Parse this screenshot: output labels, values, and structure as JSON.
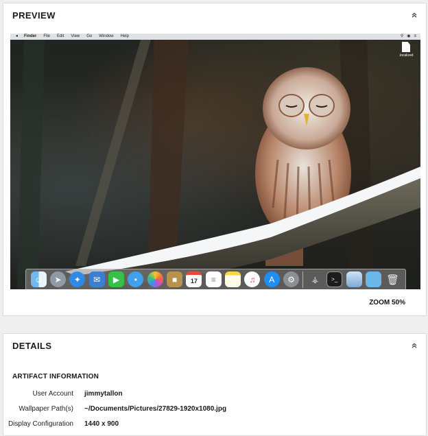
{
  "preview": {
    "title": "PREVIEW",
    "zoom_label": "ZOOM 50%",
    "menubar": {
      "apple_icon": "apple-icon",
      "items": [
        "Finder",
        "File",
        "Edit",
        "View",
        "Go",
        "Window",
        "Help"
      ]
    },
    "desktop_file_label": ".localized",
    "dock_apps": [
      "Finder",
      "Launchpad",
      "Safari",
      "Mail",
      "FaceTime",
      "Messages",
      "Photos",
      "Contacts",
      "Calendar",
      "Reminders",
      "Notes",
      "iTunes",
      "App Store",
      "System Preferences",
      "Keychain Access",
      "Terminal",
      "Preview",
      "Downloads",
      "Trash"
    ],
    "calendar_day": "17"
  },
  "details": {
    "title": "DETAILS",
    "section": "ARTIFACT INFORMATION",
    "rows": [
      {
        "key": "User Account",
        "value": "jimmytallon"
      },
      {
        "key": "Wallpaper Path(s)",
        "value": "~/Documents/Pictures/27829-1920x1080.jpg"
      },
      {
        "key": "Display Configuration",
        "value": "1440 x 900"
      }
    ]
  },
  "colors": {
    "panel_bg": "#ffffff",
    "page_bg": "#efefef",
    "border": "#dcdcdc"
  }
}
